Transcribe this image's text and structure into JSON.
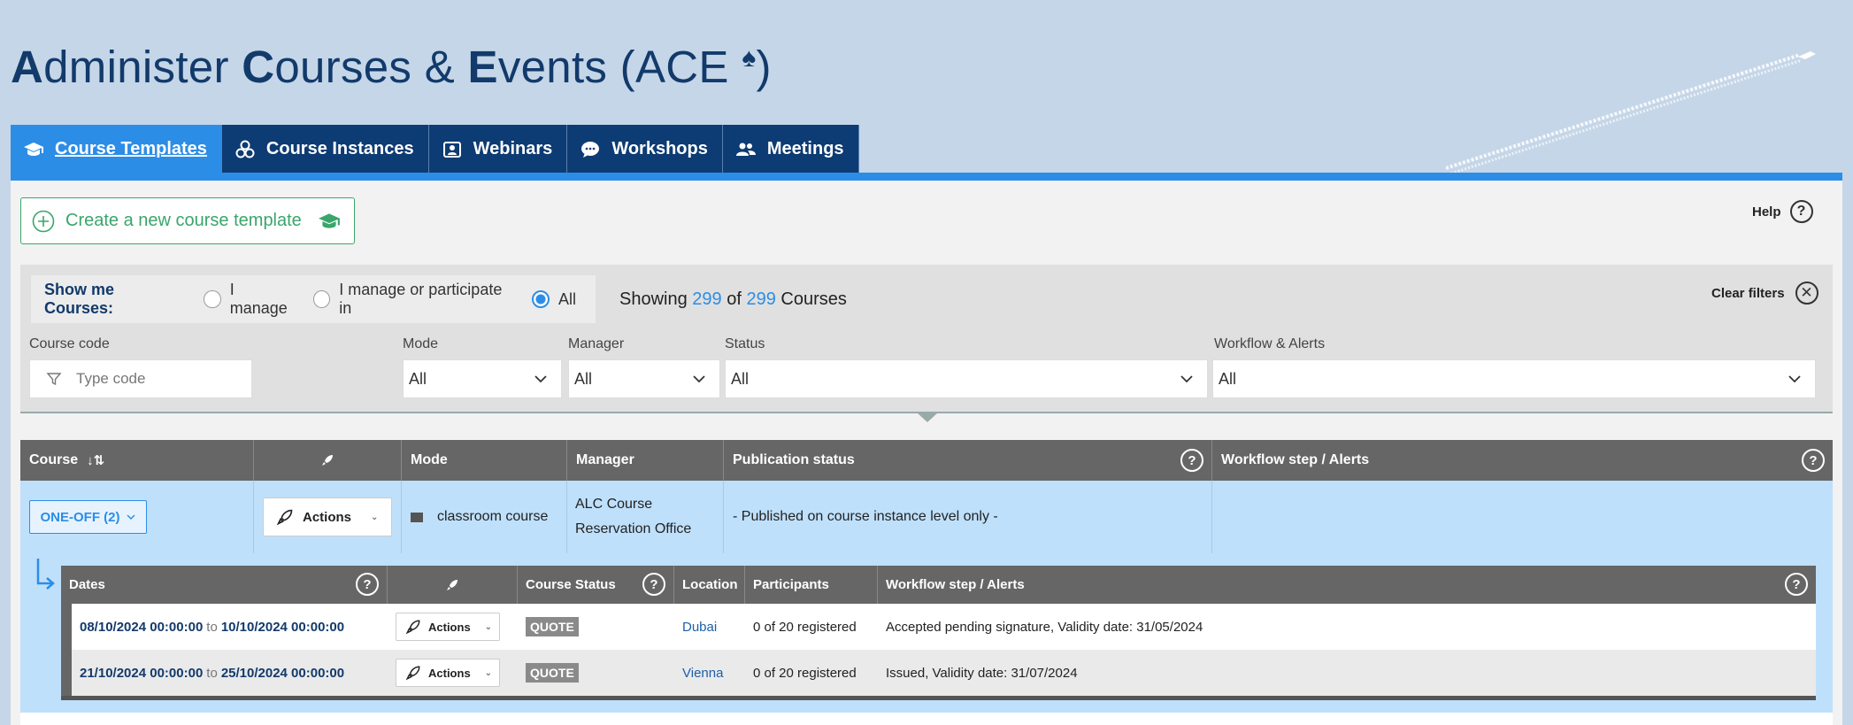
{
  "page": {
    "title_parts": [
      {
        "bold": "A",
        "rest": "dminister "
      },
      {
        "bold": "C",
        "rest": "ourses & "
      },
      {
        "bold": "E",
        "rest": "vents (ACE "
      }
    ],
    "title_spade": "♠",
    "title_end": ")"
  },
  "tabs": [
    {
      "label": "Course Templates",
      "icon": "graduation-cap-icon",
      "active": true
    },
    {
      "label": "Course Instances",
      "icon": "cubes-icon",
      "active": false
    },
    {
      "label": "Webinars",
      "icon": "presenter-icon",
      "active": false
    },
    {
      "label": "Workshops",
      "icon": "chat-bubble-icon",
      "active": false
    },
    {
      "label": "Meetings",
      "icon": "users-icon",
      "active": false
    }
  ],
  "create_button": {
    "label": "Create a new course template"
  },
  "help": {
    "label": "Help",
    "icon_glyph": "?"
  },
  "filters": {
    "show_me_label": "Show me Courses:",
    "radios": [
      {
        "label": "I manage",
        "checked": false
      },
      {
        "label": "I manage or participate in",
        "checked": false
      },
      {
        "label": "All",
        "checked": true
      }
    ],
    "showing_prefix": "Showing",
    "showing_count": "299",
    "showing_of": "of",
    "showing_total": "299",
    "showing_suffix": "Courses",
    "clear_label": "Clear filters",
    "course_code_label": "Course code",
    "course_code_placeholder": "Type code",
    "mode_label": "Mode",
    "mode_value": "All",
    "manager_label": "Manager",
    "manager_value": "All",
    "status_label": "Status",
    "status_value": "All",
    "workflow_label": "Workflow & Alerts",
    "workflow_value": "All"
  },
  "table": {
    "headers": {
      "course": "Course",
      "mode": "Mode",
      "manager": "Manager",
      "publication": "Publication status",
      "workflow": "Workflow step / Alerts"
    },
    "row": {
      "course_button": "ONE-OFF (2)",
      "actions_label": "Actions",
      "mode": "classroom course",
      "manager_line1": "ALC Course",
      "manager_line2": "Reservation Office",
      "publication": "- Published on course instance level only -",
      "workflow": ""
    }
  },
  "subtable": {
    "headers": {
      "dates": "Dates",
      "course_status": "Course Status",
      "location": "Location",
      "participants": "Participants",
      "workflow": "Workflow step / Alerts"
    },
    "rows": [
      {
        "from": "08/10/2024 00:00:00",
        "to_word": "to",
        "to": "10/10/2024 00:00:00",
        "actions": "Actions",
        "status": "QUOTE",
        "location": "Dubai",
        "participants": "0 of 20 registered",
        "workflow": "Accepted pending signature, Validity date: 31/05/2024"
      },
      {
        "from": "21/10/2024 00:00:00",
        "to_word": "to",
        "to": "25/10/2024 00:00:00",
        "actions": "Actions",
        "status": "QUOTE",
        "location": "Vienna",
        "participants": "0 of 20 registered",
        "workflow": "Issued, Validity date: 31/07/2024"
      }
    ]
  },
  "colors": {
    "page_bg": "#c5d6e8",
    "nav_dark": "#0d3b73",
    "accent_blue": "#2c8de6",
    "create_green": "#3aa56b",
    "table_header": "#666666",
    "row_highlight": "#bfe0fb"
  }
}
